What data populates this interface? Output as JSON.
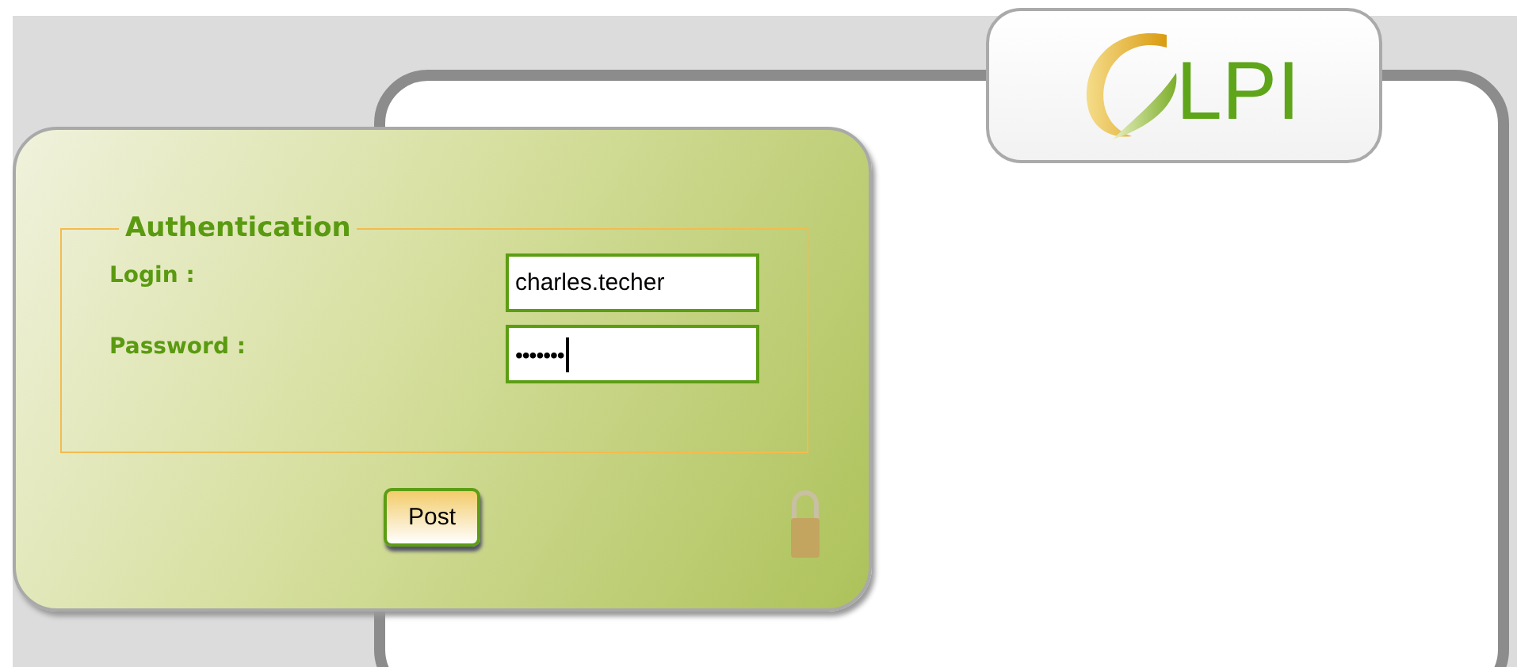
{
  "logo": {
    "text": "LPI"
  },
  "login_form": {
    "legend": "Authentication",
    "fields": [
      {
        "kind": "text",
        "label": "Login :",
        "value": "charles.techer",
        "focused": false
      },
      {
        "kind": "password",
        "label": "Password :",
        "value": "•••••••",
        "focused": true
      }
    ],
    "button": "Post",
    "locked": true
  }
}
